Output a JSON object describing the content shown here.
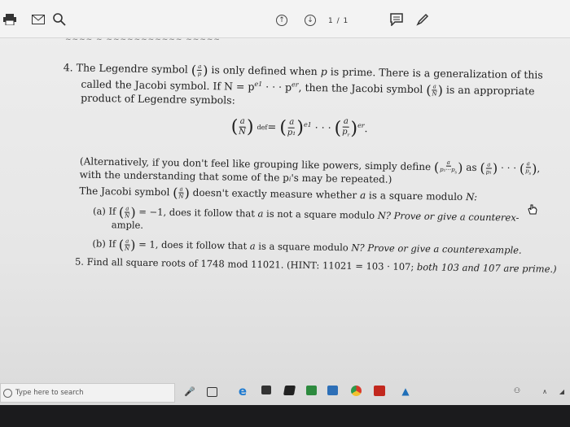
{
  "toolbar": {
    "page_indicator": "1 / 1",
    "icons": [
      "print-icon",
      "mail-icon",
      "search-icon",
      "up-arrow-icon",
      "down-arrow-icon",
      "comment-icon",
      "pen-icon"
    ]
  },
  "doc": {
    "p4_num": "4.",
    "p4_l1a": "The Legendre symbol",
    "p4_l1b": "is only defined when",
    "p4_l1c": "p",
    "p4_l1d": "is prime. There is a generalization of this",
    "p4_l2a": "called the Jacobi symbol. If N = p",
    "p4_l2b": "· · · p",
    "p4_l2c": ", then the Jacobi symbol",
    "p4_l2d": "is an appropriate",
    "p4_l3": "product of Legendre symbols:",
    "def": "def",
    "alt_l1a": "(Alternatively, if you don't feel like grouping like powers, simply define",
    "alt_l1b": "as",
    "alt_l2": "with the understanding that some of the p",
    "alt_l2b": "'s may be repeated.)",
    "jac_a": "The Jacobi symbol",
    "jac_b": "doesn't exactly measure whether",
    "jac_c": "a",
    "jac_d": "is a square modulo",
    "jac_e": "N:",
    "qa_a": "(a)  If",
    "qa_b": "= −1, does it follow that",
    "qa_c": "a",
    "qa_d": "is not a square modulo",
    "qa_e": "N? Prove or give a counterex-",
    "qa_f": "ample.",
    "qb_a": "(b)  If",
    "qb_b": "= 1, does it follow that",
    "qb_c": "a",
    "qb_d": "is a square modulo",
    "qb_e": "N? Prove or give a counterexample.",
    "p5_num": "5.",
    "p5_a": "Find all square roots of 1748 mod 11021. (HINT: 11021 = 103 · 107;",
    "p5_b": "both 103 and 107 are prime.)"
  },
  "taskbar": {
    "search_placeholder": "Type here to search"
  }
}
